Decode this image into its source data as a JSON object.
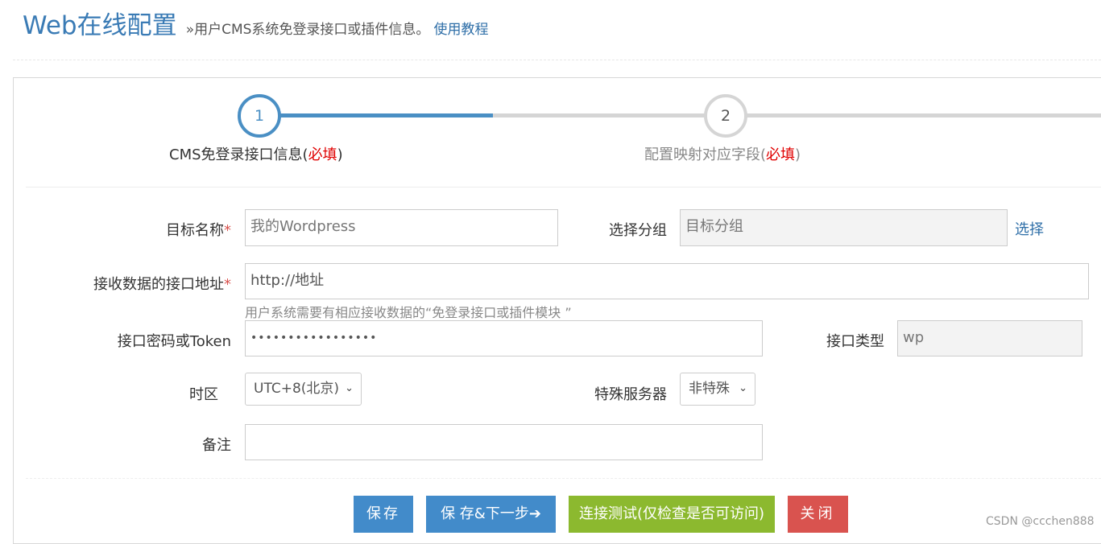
{
  "header": {
    "title": "Web在线配置",
    "subtitle": "»用户CMS系统免登录接口或插件信息。",
    "tutorial_link": "使用教程"
  },
  "steps": [
    {
      "number": "1",
      "label": "CMS免登录接口信息",
      "required_note": "必填",
      "state": "active"
    },
    {
      "number": "2",
      "label": "配置映射对应字段",
      "required_note": "必填",
      "state": "inactive"
    }
  ],
  "form": {
    "target_name": {
      "label": "目标名称",
      "required": "*",
      "placeholder": "我的Wordpress"
    },
    "group": {
      "label": "选择分组",
      "placeholder": "目标分组",
      "select_link": "选择"
    },
    "endpoint": {
      "label": "接收数据的接口地址",
      "required": "*",
      "placeholder": "http://地址",
      "help": "用户系统需要有相应接收数据的“免登录接口或插件模块 ”"
    },
    "password": {
      "label": "接口密码或Token",
      "value": "•••••••••••••••••"
    },
    "api_type": {
      "label": "接口类型",
      "value": "wp"
    },
    "timezone": {
      "label": "时区",
      "selected": "UTC+8(北京)"
    },
    "special_server": {
      "label": "特殊服务器",
      "selected": "非特殊"
    },
    "remark": {
      "label": "备注",
      "value": ""
    }
  },
  "buttons": {
    "save": "保存",
    "save_next": "保 存&下一步",
    "save_next_arrow": "➔",
    "test": "连接测试(仅检查是否可访问)",
    "close": "关闭"
  },
  "watermark": "CSDN @ccchen888",
  "colors": {
    "accent": "#428bca",
    "success": "#8cb92f",
    "danger": "#d9534f",
    "title": "#3a7bb5"
  }
}
